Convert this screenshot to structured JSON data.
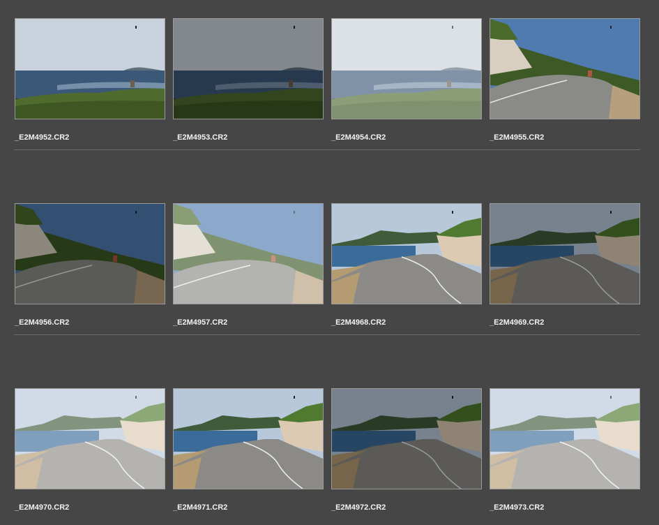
{
  "thumbnails": [
    {
      "filename": "_E2M4952.CR2",
      "scene": "sea",
      "tone": "normal"
    },
    {
      "filename": "_E2M4953.CR2",
      "scene": "sea",
      "tone": "dark"
    },
    {
      "filename": "_E2M4954.CR2",
      "scene": "sea",
      "tone": "bright"
    },
    {
      "filename": "_E2M4955.CR2",
      "scene": "curve-left",
      "tone": "normal"
    },
    {
      "filename": "_E2M4956.CR2",
      "scene": "curve-left",
      "tone": "dark"
    },
    {
      "filename": "_E2M4957.CR2",
      "scene": "curve-left",
      "tone": "bright"
    },
    {
      "filename": "_E2M4968.CR2",
      "scene": "coast-road",
      "tone": "normal"
    },
    {
      "filename": "_E2M4969.CR2",
      "scene": "coast-road",
      "tone": "dark"
    },
    {
      "filename": "_E2M4970.CR2",
      "scene": "coast-road",
      "tone": "bright"
    },
    {
      "filename": "_E2M4971.CR2",
      "scene": "coast-road",
      "tone": "normal"
    },
    {
      "filename": "_E2M4972.CR2",
      "scene": "coast-road",
      "tone": "dark"
    },
    {
      "filename": "_E2M4973.CR2",
      "scene": "coast-road",
      "tone": "bright"
    }
  ],
  "colors": {
    "background": "#464646",
    "thumb_border": "#9a9a9a",
    "label_text": "#f2f2f2",
    "divider": "#6a6a6a"
  }
}
